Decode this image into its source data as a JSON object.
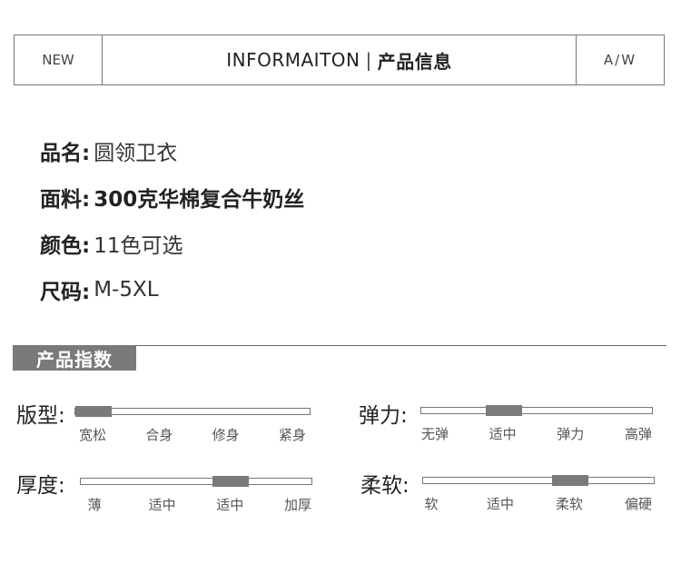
{
  "header": {
    "left": "NEW",
    "title_en": "INFORMAITON",
    "separator": "|",
    "title_cn": "产品信息",
    "right": "A/W"
  },
  "info": [
    {
      "label": "品名:",
      "value": "圆领卫衣",
      "bold": false
    },
    {
      "label": "面料:",
      "value": "300克华棉复合牛奶丝",
      "bold": true
    },
    {
      "label": "颜色:",
      "value": "11色可选",
      "bold": false
    },
    {
      "label": "尺码:",
      "value": "M-5XL",
      "bold": false
    }
  ],
  "index": {
    "title": "产品指数",
    "scales": [
      {
        "label": "版型:",
        "ticks": [
          "宽松",
          "合身",
          "修身",
          "紧身"
        ],
        "selected_index": 0
      },
      {
        "label": "弹力:",
        "ticks": [
          "无弹",
          "适中",
          "弹力",
          "高弹"
        ],
        "selected_index": 1
      },
      {
        "label": "厚度:",
        "ticks": [
          "薄",
          "适中",
          "适中",
          "加厚"
        ],
        "selected_index": 2
      },
      {
        "label": "柔软:",
        "ticks": [
          "软",
          "适中",
          "柔软",
          "偏硬"
        ],
        "selected_index": 2
      }
    ]
  },
  "colors": {
    "accent_gray": "#7a7a7a",
    "line": "#777777",
    "text": "#333333"
  }
}
